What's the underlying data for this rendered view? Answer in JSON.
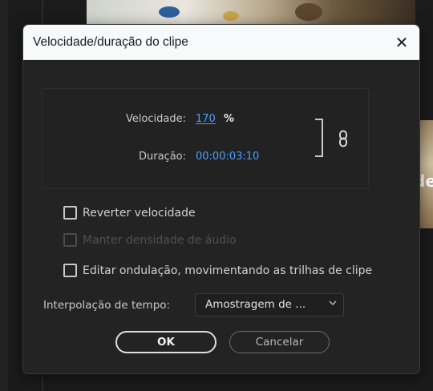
{
  "dialog": {
    "title": "Velocidade/duração do clipe",
    "close_glyph": "✕",
    "speed": {
      "label": "Velocidade:",
      "value": "170",
      "unit": "%"
    },
    "duration": {
      "label": "Duração:",
      "value": "00:00:03:10"
    },
    "link_icon": "chain-link-icon",
    "checkboxes": [
      {
        "label": "Reverter velocidade",
        "checked": false,
        "enabled": true
      },
      {
        "label": "Manter densidade de áudio",
        "checked": false,
        "enabled": false
      },
      {
        "label": "Editar ondulação, movimentando as trilhas de clipe",
        "checked": false,
        "enabled": true
      }
    ],
    "interpolation": {
      "label": "Interpolação de tempo:",
      "selected": "Amostragem de ..."
    },
    "buttons": {
      "ok": "OK",
      "cancel": "Cancelar"
    }
  },
  "background": {
    "partial_text": "de"
  },
  "colors": {
    "accent_value": "#4a9fff",
    "dialog_bg": "#232323",
    "titlebar_bg": "#f6fafb"
  }
}
